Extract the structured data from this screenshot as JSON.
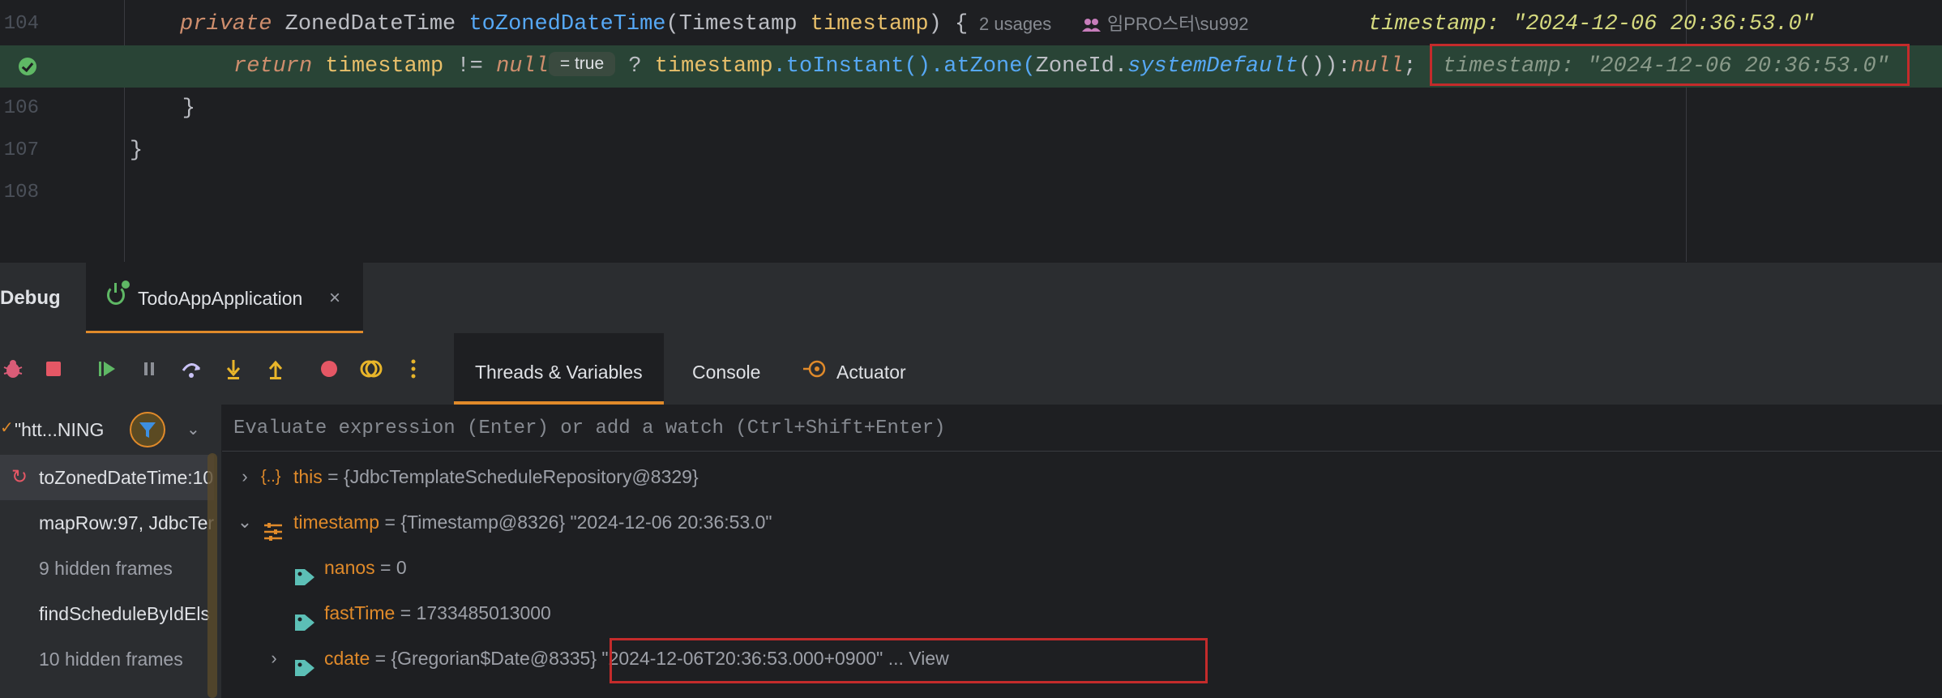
{
  "editor": {
    "lines": [
      {
        "num": "104"
      },
      {
        "num": "105"
      },
      {
        "num": "106",
        "code": "    }"
      },
      {
        "num": "107",
        "code": "}"
      },
      {
        "num": "108",
        "code": ""
      }
    ],
    "line104": {
      "kw_private": "private",
      "type": "ZonedDateTime",
      "method": "toZonedDateTime",
      "open": "(",
      "param_type": "Timestamp",
      "param": "timestamp",
      "close": ") {",
      "usages": "2 usages",
      "author": "임PRO스터\\su992",
      "inline_value": "timestamp: \"2024-12-06 20:36:53.0\""
    },
    "line105": {
      "kw_return": "return",
      "var": "timestamp",
      "op": " != ",
      "null1": "null",
      "eval_badge": "= true",
      "ternary": " ? ",
      "var2": "timestamp",
      "call1": ".toInstant().atZone(",
      "zone": "ZoneId",
      "dot": ".",
      "sysdef": "systemDefault",
      "tail": "()):",
      "null2": "null",
      "semi": ";",
      "inline_value": "timestamp: \"2024-12-06 20:36:53.0\""
    }
  },
  "debug": {
    "title": "Debug",
    "run_tab": "TodoAppApplication",
    "close": "×",
    "tabs": [
      {
        "label": "Threads & Variables",
        "active": true
      },
      {
        "label": "Console"
      },
      {
        "label": "Actuator"
      }
    ],
    "thread": "\"htt...NING",
    "frames": [
      {
        "label": "toZonedDateTime:10",
        "selected": true
      },
      {
        "label": "mapRow:97, JdbcTer"
      },
      {
        "label": "9 hidden frames",
        "hidden": true
      },
      {
        "label": "findScheduleByIdEls"
      },
      {
        "label": "10 hidden frames",
        "hidden": true
      }
    ],
    "eval_placeholder": "Evaluate expression (Enter) or add a watch (Ctrl+Shift+Enter)",
    "variables": [
      {
        "name": "this",
        "eq": " = ",
        "value": "{JdbcTemplateScheduleRepository@8329}"
      },
      {
        "name": "timestamp",
        "eq": " = ",
        "value": "{Timestamp@8326} \"2024-12-06 20:36:53.0\""
      },
      {
        "name": "nanos",
        "eq": " = ",
        "value": "0"
      },
      {
        "name": "fastTime",
        "eq": " = ",
        "value": "1733485013000"
      },
      {
        "name": "cdate",
        "eq": " = ",
        "value": "{Gregorian$Date@8335}",
        "str": "\"2024-12-06T20:36:53.000+0900\"",
        "more": " ... View"
      }
    ]
  },
  "colors": {
    "accent": "#e08a2a",
    "exec_line": "#294436",
    "highlight_box": "#c42b2b"
  }
}
